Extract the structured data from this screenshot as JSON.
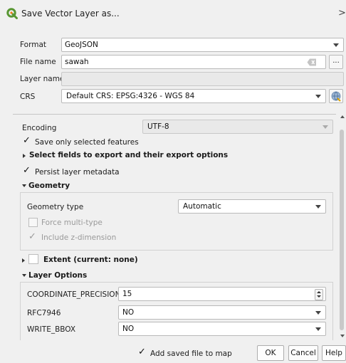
{
  "window": {
    "title": "Save Vector Layer as...",
    "close_glyph": ">"
  },
  "form": {
    "format_label": "Format",
    "format_value": "GeoJSON",
    "filename_label": "File name",
    "filename_value": "sawah",
    "browse_label": "...",
    "layername_label": "Layer name",
    "layername_value": "",
    "crs_label": "CRS",
    "crs_value": "Default CRS: EPSG:4326 - WGS 84"
  },
  "options": {
    "encoding_label": "Encoding",
    "encoding_value": "UTF-8",
    "save_selected_label": "Save only selected features",
    "select_fields_label": "Select fields to export and their export options",
    "persist_metadata_label": "Persist layer metadata",
    "geometry_header": "Geometry",
    "geometry_type_label": "Geometry type",
    "geometry_type_value": "Automatic",
    "force_multi_label": "Force multi-type",
    "include_z_label": "Include z-dimension",
    "extent_label": "Extent (current: none)",
    "layer_options_header": "Layer Options",
    "layer_options": [
      {
        "name": "COORDINATE_PRECISION",
        "value": "15"
      },
      {
        "name": "RFC7946",
        "value": "NO"
      },
      {
        "name": "WRITE_BBOX",
        "value": "NO"
      }
    ]
  },
  "footer": {
    "add_to_map_label": "Add saved file to map",
    "ok_label": "OK",
    "cancel_label": "Cancel",
    "help_label": "Help"
  },
  "checks": {
    "mark": "✓",
    "save_selected": true,
    "persist_metadata": true,
    "force_multi": false,
    "include_z": true,
    "extent": false,
    "add_to_map": true
  },
  "colors": {
    "qgis_green": "#589632",
    "qgis_yellow": "#ee7913"
  },
  "icons": {
    "app": "qgis-logo-icon",
    "clear": "clear-text-icon",
    "crs_select": "globe-icon"
  }
}
